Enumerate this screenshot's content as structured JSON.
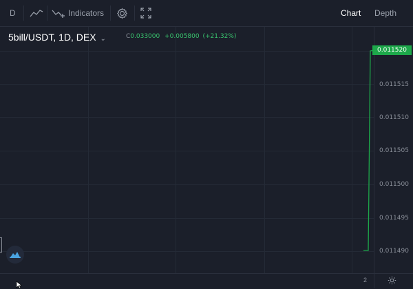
{
  "toolbar": {
    "interval": "D",
    "indicators_label": "Indicators",
    "tabs": [
      {
        "label": "Chart",
        "active": true
      },
      {
        "label": "Depth",
        "active": false
      }
    ]
  },
  "legend": {
    "symbol": "5bill/USDT, 1D, DEX",
    "ohlc_prefix": "C",
    "close": "0.033000",
    "change": "+0.005800",
    "change_pct": "(+21.32%)"
  },
  "price_axis": {
    "ticks": [
      "0.011515",
      "0.011510",
      "0.011505",
      "0.011500",
      "0.011495",
      "0.011490"
    ],
    "last_price": "0.011520"
  },
  "time_axis": {
    "label": "2"
  },
  "colors": {
    "background": "#1b1f2a",
    "up": "#1da84a",
    "text_up": "#39c46e",
    "grid": "#242a36"
  }
}
